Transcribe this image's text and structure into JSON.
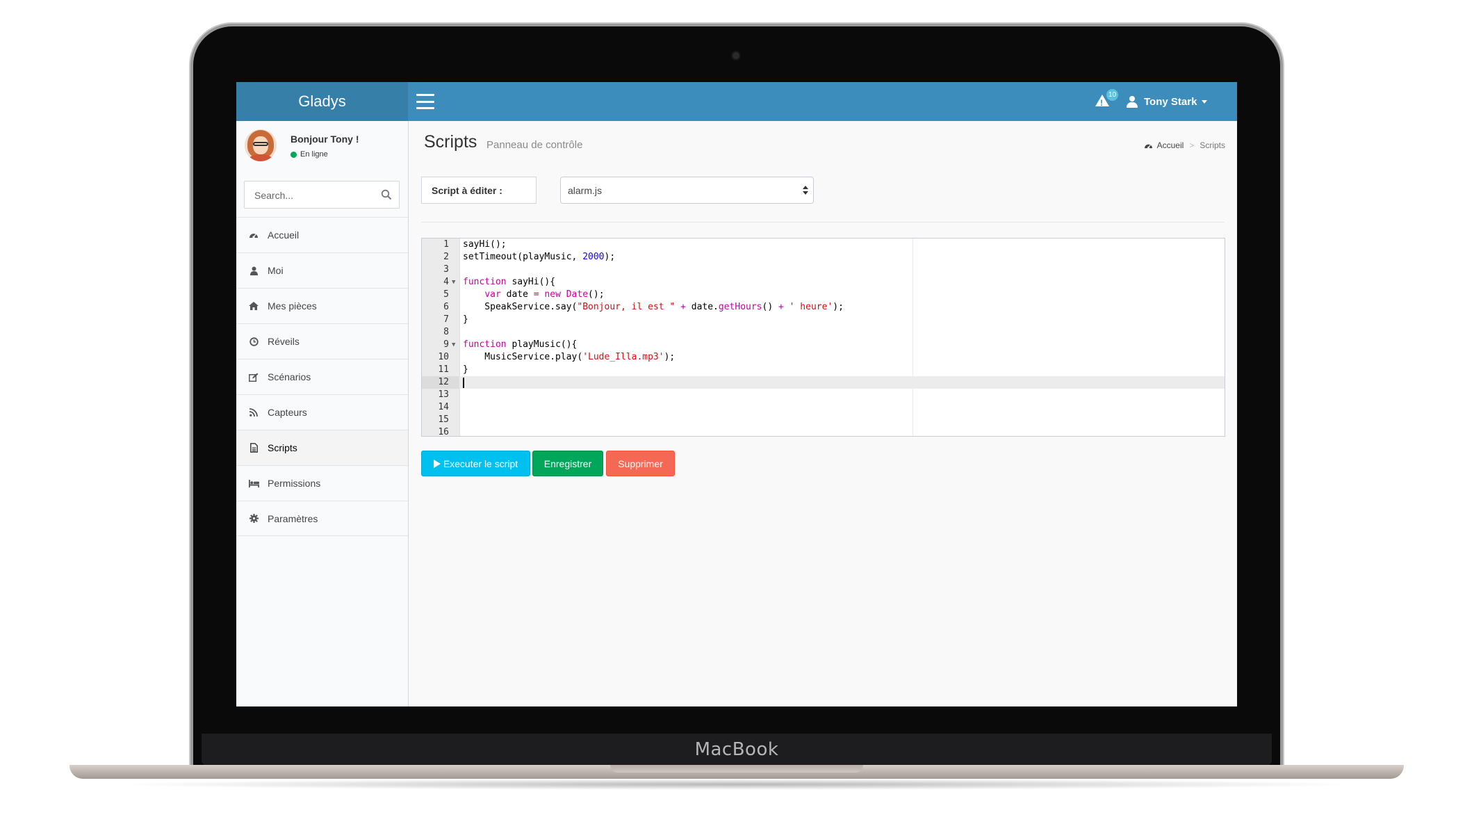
{
  "device": {
    "brand_label": "MacBook"
  },
  "app": {
    "brand": "Gladys"
  },
  "topbar": {
    "notifications": {
      "count": "10",
      "icon": "warning-icon"
    },
    "user_name": "Tony Stark",
    "header_color": "#3c8dbc",
    "brand_color": "#367fa9"
  },
  "sidebar": {
    "greeting": "Bonjour Tony !",
    "status": "En ligne",
    "status_color": "#00a65a",
    "search": {
      "placeholder": "Search..."
    },
    "items": [
      {
        "label": "Accueil",
        "icon": "dashboard-icon"
      },
      {
        "label": "Moi",
        "icon": "user-icon"
      },
      {
        "label": "Mes pièces",
        "icon": "home-icon"
      },
      {
        "label": "Réveils",
        "icon": "clock-icon"
      },
      {
        "label": "Scénarios",
        "icon": "edit-icon"
      },
      {
        "label": "Capteurs",
        "icon": "rss-icon"
      },
      {
        "label": "Scripts",
        "icon": "file-icon",
        "active": true
      },
      {
        "label": "Permissions",
        "icon": "bed-icon"
      },
      {
        "label": "Paramètres",
        "icon": "gear-icon"
      }
    ]
  },
  "page": {
    "title": "Scripts",
    "subtitle": "Panneau de contrôle",
    "breadcrumb": {
      "home": "Accueil",
      "current": "Scripts"
    }
  },
  "script_form": {
    "label": "Script à éditer :",
    "selected": "alarm.js"
  },
  "editor": {
    "active_line": 12,
    "lines": [
      {
        "n": "1",
        "fold": false
      },
      {
        "n": "2",
        "fold": false
      },
      {
        "n": "3",
        "fold": false
      },
      {
        "n": "4",
        "fold": true
      },
      {
        "n": "5",
        "fold": false
      },
      {
        "n": "6",
        "fold": false
      },
      {
        "n": "7",
        "fold": false
      },
      {
        "n": "8",
        "fold": false
      },
      {
        "n": "9",
        "fold": true
      },
      {
        "n": "10",
        "fold": false
      },
      {
        "n": "11",
        "fold": false
      },
      {
        "n": "12",
        "fold": false
      },
      {
        "n": "13",
        "fold": false
      },
      {
        "n": "14",
        "fold": false
      },
      {
        "n": "15",
        "fold": false
      },
      {
        "n": "16",
        "fold": false
      }
    ],
    "code": {
      "l1": "sayHi();",
      "l2_a": "setTimeout(playMusic, ",
      "l2_num": "2000",
      "l2_b": ");",
      "l4_kw": "function",
      "l4_b": " sayHi(){",
      "l5_indent": "    ",
      "l5_kw": "var",
      "l5_b": " date ",
      "l5_op": "=",
      "l5_sp": " ",
      "l5_kw2": "new",
      "l5_sp2": " ",
      "l5_cls": "Date",
      "l5_c": "();",
      "l6_a": "    SpeakService.say(",
      "l6_str": "\"Bonjour, il est \"",
      "l6_sp": " ",
      "l6_op": "+",
      "l6_b": " date.",
      "l6_fn": "getHours",
      "l6_c": "() ",
      "l6_op2": "+",
      "l6_sp2": " ",
      "l6_str2": "' heure'",
      "l6_d": ");",
      "l7": "}",
      "l9_kw": "function",
      "l9_b": " playMusic(){",
      "l10_a": "    MusicService.play(",
      "l10_str": "'Lude_Illa.mp3'",
      "l10_b": ");",
      "l11": "}"
    }
  },
  "actions": {
    "run": "Executer le script",
    "save": "Enregistrer",
    "delete": "Supprimer",
    "run_color": "#00c0ef",
    "save_color": "#00a65a",
    "delete_color": "#f56954"
  }
}
